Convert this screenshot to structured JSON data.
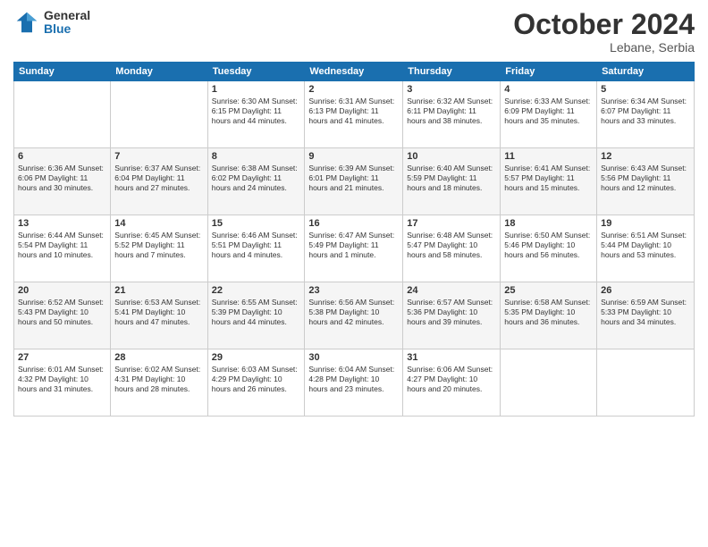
{
  "logo": {
    "general": "General",
    "blue": "Blue"
  },
  "title": "October 2024",
  "location": "Lebane, Serbia",
  "days_of_week": [
    "Sunday",
    "Monday",
    "Tuesday",
    "Wednesday",
    "Thursday",
    "Friday",
    "Saturday"
  ],
  "weeks": [
    [
      {
        "day": "",
        "info": ""
      },
      {
        "day": "",
        "info": ""
      },
      {
        "day": "1",
        "info": "Sunrise: 6:30 AM\nSunset: 6:15 PM\nDaylight: 11 hours and 44 minutes."
      },
      {
        "day": "2",
        "info": "Sunrise: 6:31 AM\nSunset: 6:13 PM\nDaylight: 11 hours and 41 minutes."
      },
      {
        "day": "3",
        "info": "Sunrise: 6:32 AM\nSunset: 6:11 PM\nDaylight: 11 hours and 38 minutes."
      },
      {
        "day": "4",
        "info": "Sunrise: 6:33 AM\nSunset: 6:09 PM\nDaylight: 11 hours and 35 minutes."
      },
      {
        "day": "5",
        "info": "Sunrise: 6:34 AM\nSunset: 6:07 PM\nDaylight: 11 hours and 33 minutes."
      }
    ],
    [
      {
        "day": "6",
        "info": "Sunrise: 6:36 AM\nSunset: 6:06 PM\nDaylight: 11 hours and 30 minutes."
      },
      {
        "day": "7",
        "info": "Sunrise: 6:37 AM\nSunset: 6:04 PM\nDaylight: 11 hours and 27 minutes."
      },
      {
        "day": "8",
        "info": "Sunrise: 6:38 AM\nSunset: 6:02 PM\nDaylight: 11 hours and 24 minutes."
      },
      {
        "day": "9",
        "info": "Sunrise: 6:39 AM\nSunset: 6:01 PM\nDaylight: 11 hours and 21 minutes."
      },
      {
        "day": "10",
        "info": "Sunrise: 6:40 AM\nSunset: 5:59 PM\nDaylight: 11 hours and 18 minutes."
      },
      {
        "day": "11",
        "info": "Sunrise: 6:41 AM\nSunset: 5:57 PM\nDaylight: 11 hours and 15 minutes."
      },
      {
        "day": "12",
        "info": "Sunrise: 6:43 AM\nSunset: 5:56 PM\nDaylight: 11 hours and 12 minutes."
      }
    ],
    [
      {
        "day": "13",
        "info": "Sunrise: 6:44 AM\nSunset: 5:54 PM\nDaylight: 11 hours and 10 minutes."
      },
      {
        "day": "14",
        "info": "Sunrise: 6:45 AM\nSunset: 5:52 PM\nDaylight: 11 hours and 7 minutes."
      },
      {
        "day": "15",
        "info": "Sunrise: 6:46 AM\nSunset: 5:51 PM\nDaylight: 11 hours and 4 minutes."
      },
      {
        "day": "16",
        "info": "Sunrise: 6:47 AM\nSunset: 5:49 PM\nDaylight: 11 hours and 1 minute."
      },
      {
        "day": "17",
        "info": "Sunrise: 6:48 AM\nSunset: 5:47 PM\nDaylight: 10 hours and 58 minutes."
      },
      {
        "day": "18",
        "info": "Sunrise: 6:50 AM\nSunset: 5:46 PM\nDaylight: 10 hours and 56 minutes."
      },
      {
        "day": "19",
        "info": "Sunrise: 6:51 AM\nSunset: 5:44 PM\nDaylight: 10 hours and 53 minutes."
      }
    ],
    [
      {
        "day": "20",
        "info": "Sunrise: 6:52 AM\nSunset: 5:43 PM\nDaylight: 10 hours and 50 minutes."
      },
      {
        "day": "21",
        "info": "Sunrise: 6:53 AM\nSunset: 5:41 PM\nDaylight: 10 hours and 47 minutes."
      },
      {
        "day": "22",
        "info": "Sunrise: 6:55 AM\nSunset: 5:39 PM\nDaylight: 10 hours and 44 minutes."
      },
      {
        "day": "23",
        "info": "Sunrise: 6:56 AM\nSunset: 5:38 PM\nDaylight: 10 hours and 42 minutes."
      },
      {
        "day": "24",
        "info": "Sunrise: 6:57 AM\nSunset: 5:36 PM\nDaylight: 10 hours and 39 minutes."
      },
      {
        "day": "25",
        "info": "Sunrise: 6:58 AM\nSunset: 5:35 PM\nDaylight: 10 hours and 36 minutes."
      },
      {
        "day": "26",
        "info": "Sunrise: 6:59 AM\nSunset: 5:33 PM\nDaylight: 10 hours and 34 minutes."
      }
    ],
    [
      {
        "day": "27",
        "info": "Sunrise: 6:01 AM\nSunset: 4:32 PM\nDaylight: 10 hours and 31 minutes."
      },
      {
        "day": "28",
        "info": "Sunrise: 6:02 AM\nSunset: 4:31 PM\nDaylight: 10 hours and 28 minutes."
      },
      {
        "day": "29",
        "info": "Sunrise: 6:03 AM\nSunset: 4:29 PM\nDaylight: 10 hours and 26 minutes."
      },
      {
        "day": "30",
        "info": "Sunrise: 6:04 AM\nSunset: 4:28 PM\nDaylight: 10 hours and 23 minutes."
      },
      {
        "day": "31",
        "info": "Sunrise: 6:06 AM\nSunset: 4:27 PM\nDaylight: 10 hours and 20 minutes."
      },
      {
        "day": "",
        "info": ""
      },
      {
        "day": "",
        "info": ""
      }
    ]
  ]
}
